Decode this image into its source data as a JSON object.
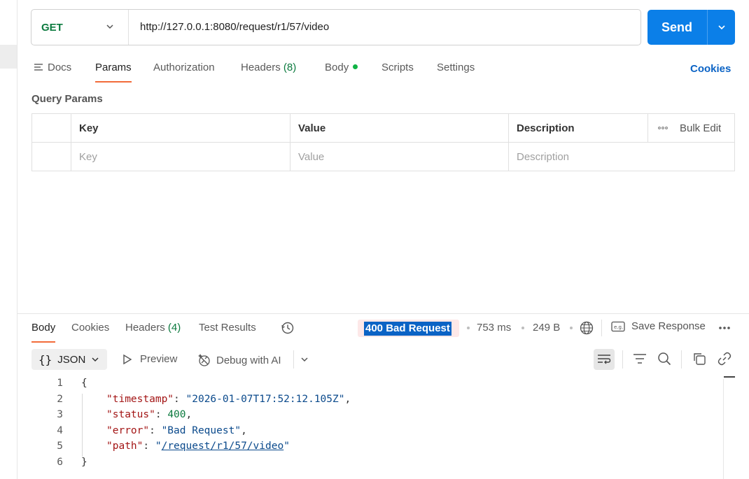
{
  "request": {
    "method": "GET",
    "url": "http://127.0.0.1:8080/request/r1/57/video",
    "send_label": "Send"
  },
  "request_tabs": {
    "docs": "Docs",
    "params": "Params",
    "authorization": "Authorization",
    "headers": "Headers",
    "headers_count": "(8)",
    "body": "Body",
    "scripts": "Scripts",
    "settings": "Settings",
    "cookies": "Cookies"
  },
  "query_params": {
    "title": "Query Params",
    "columns": [
      "Key",
      "Value",
      "Description"
    ],
    "bulk_edit": "Bulk Edit",
    "placeholders": [
      "Key",
      "Value",
      "Description"
    ]
  },
  "response": {
    "tabs": {
      "body": "Body",
      "cookies": "Cookies",
      "headers": "Headers",
      "headers_count": "(4)",
      "test_results": "Test Results"
    },
    "status": "400 Bad Request",
    "time": "753 ms",
    "size": "249 B",
    "save_response": "Save Response",
    "format": "JSON",
    "preview": "Preview",
    "debug_ai": "Debug with AI",
    "line_numbers": [
      "1",
      "2",
      "3",
      "4",
      "5",
      "6"
    ],
    "json": {
      "open": "{",
      "close": "}",
      "timestamp_key": "\"timestamp\"",
      "timestamp_val": "\"2026-01-07T17:52:12.105Z\"",
      "status_key": "\"status\"",
      "status_val": "400",
      "error_key": "\"error\"",
      "error_val": "\"Bad Request\"",
      "path_key": "\"path\"",
      "path_val": "/request/r1/57/video"
    }
  },
  "colors": {
    "accent": "#0b7fe8",
    "method_green": "#0b7a3e",
    "tab_underline": "#f26b3a",
    "status_highlight": "#0b63c5"
  },
  "icons": [
    "chevron-down-icon",
    "docs-icon",
    "more-icon",
    "history-icon",
    "globe-icon",
    "example-icon",
    "preview-icon",
    "debug-ai-icon",
    "wrap-icon",
    "filter-icon",
    "search-icon",
    "copy-icon",
    "link-icon"
  ]
}
